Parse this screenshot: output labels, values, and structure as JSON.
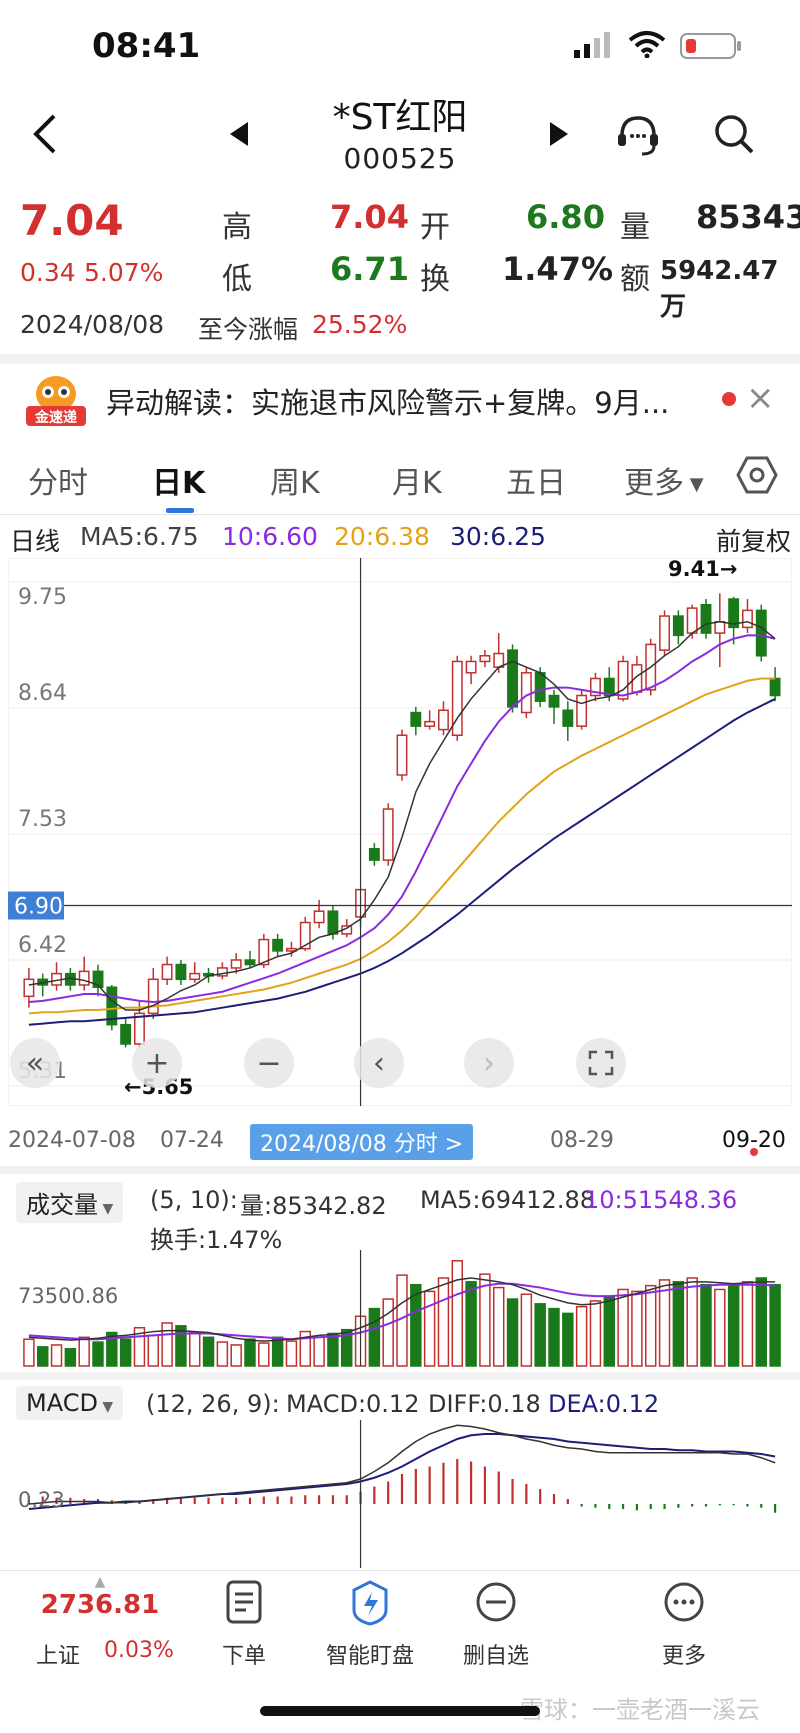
{
  "status_bar": {
    "time": "08:41",
    "icons": [
      "signal-icon",
      "wifi-icon",
      "battery-low-icon"
    ]
  },
  "header": {
    "title": "*ST红阳",
    "code": "000525",
    "icons": [
      "back-arrow-icon",
      "prev-stock-icon",
      "next-stock-icon",
      "customer-service-icon",
      "search-icon"
    ]
  },
  "quote": {
    "price": "7.04",
    "change": "0.34",
    "change_pct": "5.07%",
    "high_label": "高",
    "high": "7.04",
    "low_label": "低",
    "low": "6.71",
    "open_label": "开",
    "open": "6.80",
    "turnover_label": "换",
    "turnover": "1.47%",
    "volume_label": "量",
    "volume": "85343",
    "amount_label": "额",
    "amount": "5942.47万",
    "date": "2024/08/08",
    "since_label": "至今涨幅",
    "since_value": "25.52%"
  },
  "news": {
    "badge": "金速递",
    "text": "异动解读：实施退市风险警示+复牌。9月...",
    "close": "×"
  },
  "tabs": [
    "分时",
    "日K",
    "周K",
    "月K",
    "五日",
    "更多"
  ],
  "tabs_selected": "日K",
  "legend": {
    "line": "日线",
    "ma5": "MA5:6.75",
    "ma10": "10:6.60",
    "ma20": "20:6.38",
    "ma30": "30:6.25",
    "adjust": "前复权"
  },
  "colors": {
    "up": "#c0302e",
    "down": "#1a7a1a",
    "ma5": "#333333",
    "ma10": "#8a2be2",
    "ma20": "#e3a21a",
    "ma30": "#1c1f7a",
    "accent": "#2f76d8"
  },
  "chart_data": {
    "type": "candlestick",
    "y_ticks": [
      "9.75",
      "8.64",
      "7.53",
      "6.42",
      "5.31"
    ],
    "ylim": [
      5.31,
      9.75
    ],
    "crosshair_price": "6.90",
    "max_label": "9.41→",
    "min_label": "←5.65",
    "x_labels": [
      "2024-07-08",
      "07-24",
      "08-29",
      "09-20"
    ],
    "crosshair_date_label": "2024/08/08 分时 >",
    "candles": [
      [
        6.1,
        6.25,
        6.35,
        6.0
      ],
      [
        6.25,
        6.2,
        6.3,
        6.1
      ],
      [
        6.2,
        6.3,
        6.4,
        6.15
      ],
      [
        6.3,
        6.2,
        6.35,
        6.15
      ],
      [
        6.2,
        6.32,
        6.45,
        6.15
      ],
      [
        6.32,
        6.18,
        6.38,
        6.1
      ],
      [
        6.18,
        5.85,
        6.2,
        5.8
      ],
      [
        5.85,
        5.68,
        5.9,
        5.65
      ],
      [
        5.68,
        5.95,
        6.05,
        5.65
      ],
      [
        5.95,
        6.25,
        6.35,
        5.9
      ],
      [
        6.25,
        6.38,
        6.45,
        6.2
      ],
      [
        6.38,
        6.25,
        6.42,
        6.2
      ],
      [
        6.25,
        6.3,
        6.4,
        6.22
      ],
      [
        6.3,
        6.28,
        6.35,
        6.22
      ],
      [
        6.28,
        6.35,
        6.4,
        6.25
      ],
      [
        6.35,
        6.42,
        6.48,
        6.3
      ],
      [
        6.42,
        6.38,
        6.5,
        6.35
      ],
      [
        6.38,
        6.6,
        6.65,
        6.35
      ],
      [
        6.6,
        6.5,
        6.65,
        6.45
      ],
      [
        6.5,
        6.52,
        6.58,
        6.45
      ],
      [
        6.52,
        6.75,
        6.8,
        6.5
      ],
      [
        6.75,
        6.85,
        6.95,
        6.7
      ],
      [
        6.85,
        6.65,
        6.9,
        6.6
      ],
      [
        6.65,
        6.72,
        6.78,
        6.62
      ],
      [
        6.8,
        7.04,
        7.04,
        6.71
      ],
      [
        7.4,
        7.3,
        7.45,
        7.25
      ],
      [
        7.3,
        7.75,
        7.8,
        7.25
      ],
      [
        8.05,
        8.4,
        8.45,
        8.0
      ],
      [
        8.6,
        8.48,
        8.65,
        8.4
      ],
      [
        8.48,
        8.52,
        8.62,
        8.45
      ],
      [
        8.45,
        8.62,
        8.7,
        8.4
      ],
      [
        8.4,
        9.05,
        9.1,
        8.35
      ],
      [
        8.95,
        9.05,
        9.1,
        8.85
      ],
      [
        9.05,
        9.1,
        9.15,
        9.0
      ],
      [
        9.0,
        9.12,
        9.3,
        8.95
      ],
      [
        9.15,
        8.65,
        9.2,
        8.6
      ],
      [
        8.6,
        8.95,
        9.0,
        8.55
      ],
      [
        8.95,
        8.7,
        9.0,
        8.65
      ],
      [
        8.75,
        8.65,
        8.8,
        8.5
      ],
      [
        8.62,
        8.48,
        8.7,
        8.35
      ],
      [
        8.48,
        8.75,
        8.8,
        8.45
      ],
      [
        8.75,
        8.9,
        8.95,
        8.7
      ],
      [
        8.9,
        8.75,
        9.0,
        8.7
      ],
      [
        8.72,
        9.05,
        9.1,
        8.7
      ],
      [
        8.78,
        9.02,
        9.1,
        8.75
      ],
      [
        8.8,
        9.2,
        9.25,
        8.75
      ],
      [
        9.15,
        9.45,
        9.5,
        9.1
      ],
      [
        9.45,
        9.28,
        9.5,
        9.2
      ],
      [
        9.3,
        9.52,
        9.55,
        9.25
      ],
      [
        9.55,
        9.3,
        9.6,
        9.25
      ],
      [
        9.3,
        9.4,
        9.65,
        9.0
      ],
      [
        9.6,
        9.35,
        9.62,
        9.2
      ],
      [
        9.35,
        9.5,
        9.6,
        9.3
      ],
      [
        9.5,
        9.1,
        9.55,
        9.05
      ],
      [
        8.9,
        8.75,
        9.0,
        8.7
      ]
    ],
    "ma5": [
      6.2,
      6.22,
      6.24,
      6.26,
      6.24,
      6.2,
      6.06,
      5.98,
      5.98,
      6.02,
      6.08,
      6.15,
      6.2,
      6.28,
      6.3,
      6.32,
      6.35,
      6.4,
      6.45,
      6.48,
      6.55,
      6.62,
      6.65,
      6.7,
      6.78,
      6.95,
      7.15,
      7.5,
      7.9,
      8.15,
      8.35,
      8.55,
      8.72,
      8.86,
      9.0,
      9.05,
      9.0,
      8.95,
      8.85,
      8.72,
      8.68,
      8.72,
      8.74,
      8.8,
      8.92,
      9.0,
      9.1,
      9.18,
      9.3,
      9.38,
      9.4,
      9.38,
      9.4,
      9.35,
      9.25
    ],
    "ma10": [
      6.05,
      6.06,
      6.08,
      6.1,
      6.12,
      6.12,
      6.1,
      6.08,
      6.06,
      6.05,
      6.06,
      6.08,
      6.1,
      6.12,
      6.14,
      6.18,
      6.22,
      6.26,
      6.3,
      6.35,
      6.4,
      6.45,
      6.5,
      6.55,
      6.62,
      6.7,
      6.82,
      6.98,
      7.2,
      7.45,
      7.7,
      7.95,
      8.15,
      8.35,
      8.52,
      8.65,
      8.75,
      8.8,
      8.82,
      8.82,
      8.8,
      8.78,
      8.76,
      8.75,
      8.78,
      8.82,
      8.88,
      8.96,
      9.05,
      9.12,
      9.2,
      9.25,
      9.28,
      9.28,
      9.25
    ],
    "ma20": [
      5.95,
      5.96,
      5.96,
      5.97,
      5.98,
      5.98,
      5.99,
      6.0,
      6.0,
      6.01,
      6.02,
      6.04,
      6.06,
      6.08,
      6.1,
      6.12,
      6.14,
      6.16,
      6.19,
      6.22,
      6.26,
      6.3,
      6.34,
      6.38,
      6.43,
      6.5,
      6.58,
      6.68,
      6.8,
      6.94,
      7.08,
      7.22,
      7.36,
      7.5,
      7.64,
      7.76,
      7.88,
      7.98,
      8.08,
      8.15,
      8.22,
      8.28,
      8.34,
      8.4,
      8.46,
      8.52,
      8.58,
      8.64,
      8.7,
      8.76,
      8.8,
      8.84,
      8.88,
      8.9,
      8.9
    ],
    "ma30": [
      5.85,
      5.86,
      5.87,
      5.88,
      5.88,
      5.89,
      5.9,
      5.91,
      5.92,
      5.93,
      5.94,
      5.95,
      5.96,
      5.98,
      6.0,
      6.02,
      6.04,
      6.06,
      6.08,
      6.11,
      6.14,
      6.18,
      6.22,
      6.26,
      6.3,
      6.35,
      6.41,
      6.48,
      6.56,
      6.64,
      6.73,
      6.82,
      6.92,
      7.02,
      7.12,
      7.22,
      7.31,
      7.4,
      7.49,
      7.57,
      7.65,
      7.73,
      7.81,
      7.89,
      7.97,
      8.05,
      8.13,
      8.21,
      8.29,
      8.37,
      8.45,
      8.53,
      8.6,
      8.66,
      8.72
    ]
  },
  "controls": [
    "double-left-icon",
    "zoom-in-icon",
    "zoom-out-icon",
    "scroll-left-icon",
    "scroll-right-icon",
    "fullscreen-icon"
  ],
  "volume_panel": {
    "tag": "成交量",
    "params": "(5, 10):",
    "vol": "量:85342.82",
    "ma5": "MA5:69412.88",
    "ma10": "10:51548.36",
    "turnover": "换手:1.47%",
    "axis_label": "73500.86",
    "bars": [
      28,
      20,
      22,
      18,
      30,
      25,
      35,
      28,
      40,
      32,
      45,
      42,
      35,
      30,
      25,
      22,
      28,
      24,
      30,
      26,
      36,
      30,
      34,
      38,
      52,
      60,
      70,
      95,
      85,
      78,
      92,
      110,
      88,
      96,
      82,
      70,
      75,
      65,
      60,
      55,
      62,
      68,
      72,
      80,
      78,
      84,
      90,
      88,
      92,
      85,
      80,
      86,
      88,
      92,
      85
    ],
    "bar_up": [
      1,
      0,
      1,
      0,
      1,
      0,
      0,
      0,
      1,
      1,
      1,
      0,
      1,
      0,
      1,
      1,
      0,
      1,
      0,
      1,
      1,
      1,
      0,
      0,
      1,
      0,
      1,
      1,
      0,
      1,
      1,
      1,
      0,
      1,
      1,
      0,
      1,
      0,
      0,
      0,
      1,
      1,
      0,
      1,
      1,
      1,
      1,
      0,
      1,
      0,
      1,
      0,
      1,
      0,
      0
    ],
    "ma_line5": [
      30,
      29,
      28,
      27,
      28,
      29,
      31,
      32,
      34,
      36,
      37,
      37,
      36,
      35,
      32,
      29,
      27,
      26,
      27,
      28,
      30,
      32,
      33,
      35,
      40,
      46,
      55,
      66,
      75,
      80,
      85,
      90,
      92,
      90,
      88,
      85,
      80,
      74,
      70,
      66,
      64,
      65,
      68,
      72,
      76,
      80,
      84,
      86,
      88,
      88,
      87,
      86,
      87,
      88,
      88
    ],
    "ma_line10": [
      32,
      31,
      30,
      29,
      28,
      28,
      29,
      30,
      31,
      32,
      33,
      34,
      34,
      34,
      33,
      32,
      31,
      30,
      29,
      28,
      29,
      30,
      31,
      32,
      35,
      39,
      44,
      50,
      57,
      63,
      69,
      75,
      80,
      84,
      86,
      86,
      84,
      82,
      79,
      76,
      74,
      73,
      73,
      74,
      75,
      77,
      79,
      81,
      83,
      84,
      85,
      85,
      85,
      85,
      84
    ]
  },
  "macd_panel": {
    "tag": "MACD",
    "params": "(12, 26, 9):",
    "macd": "MACD:0.12",
    "diff": "DIFF:0.18",
    "dea": "DEA:0.12",
    "axis_label": "0.23",
    "hist": [
      0.06,
      0.06,
      0.05,
      0.05,
      0.04,
      0.04,
      0.03,
      0.02,
      0.03,
      0.04,
      0.05,
      0.05,
      0.05,
      0.05,
      0.05,
      0.05,
      0.05,
      0.06,
      0.06,
      0.06,
      0.07,
      0.07,
      0.07,
      0.07,
      0.1,
      0.14,
      0.18,
      0.24,
      0.28,
      0.3,
      0.33,
      0.36,
      0.34,
      0.3,
      0.26,
      0.2,
      0.16,
      0.12,
      0.08,
      0.04,
      -0.02,
      -0.03,
      -0.04,
      -0.04,
      -0.05,
      -0.04,
      -0.04,
      -0.03,
      -0.02,
      -0.02,
      -0.01,
      -0.01,
      -0.02,
      -0.03,
      -0.07
    ],
    "diff_line": [
      0.0,
      0.01,
      0.02,
      0.02,
      0.02,
      0.02,
      0.01,
      0.01,
      0.02,
      0.03,
      0.04,
      0.05,
      0.06,
      0.07,
      0.08,
      0.09,
      0.1,
      0.11,
      0.12,
      0.13,
      0.14,
      0.15,
      0.16,
      0.17,
      0.2,
      0.26,
      0.33,
      0.42,
      0.5,
      0.56,
      0.6,
      0.63,
      0.62,
      0.6,
      0.57,
      0.55,
      0.52,
      0.5,
      0.47,
      0.45,
      0.44,
      0.42,
      0.41,
      0.41,
      0.41,
      0.41,
      0.41,
      0.41,
      0.41,
      0.41,
      0.41,
      0.4,
      0.4,
      0.37,
      0.33
    ],
    "dea_line": [
      -0.04,
      -0.03,
      -0.02,
      -0.01,
      0.0,
      0.01,
      0.01,
      0.02,
      0.02,
      0.03,
      0.04,
      0.05,
      0.06,
      0.07,
      0.08,
      0.08,
      0.09,
      0.1,
      0.11,
      0.12,
      0.13,
      0.14,
      0.15,
      0.16,
      0.18,
      0.21,
      0.25,
      0.3,
      0.36,
      0.42,
      0.47,
      0.52,
      0.55,
      0.56,
      0.56,
      0.55,
      0.54,
      0.53,
      0.52,
      0.5,
      0.49,
      0.48,
      0.47,
      0.46,
      0.45,
      0.44,
      0.44,
      0.43,
      0.43,
      0.42,
      0.42,
      0.42,
      0.41,
      0.4,
      0.38
    ]
  },
  "bottom_nav": {
    "index_value": "2736.81",
    "index_name": "上证",
    "index_change": "0.03%",
    "items": [
      "下单",
      "智能盯盘",
      "删自选",
      "更多"
    ]
  },
  "watermark": "雪球：一壶老酒一溪云"
}
